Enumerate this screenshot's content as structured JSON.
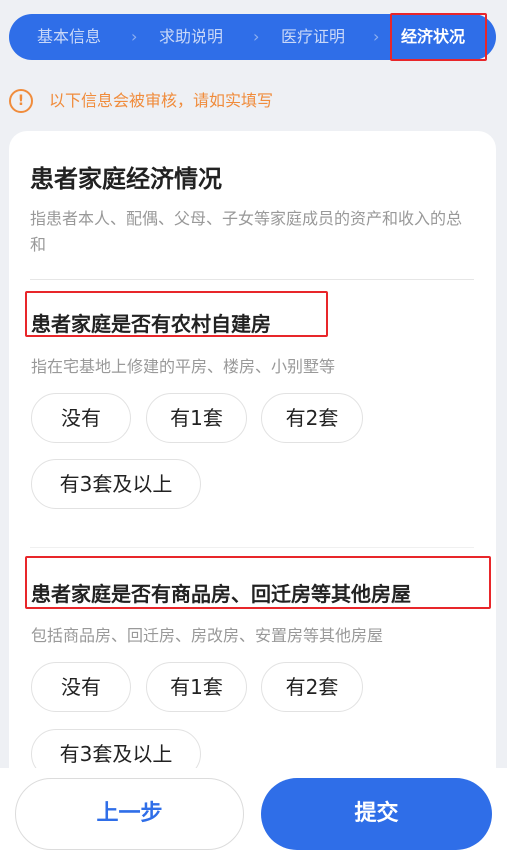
{
  "steps": {
    "step1": "基本信息",
    "step2": "求助说明",
    "step3": "医疗证明",
    "step4": "经济状况",
    "separator": "›"
  },
  "notice": {
    "icon": "!",
    "text": "以下信息会被审核，请如实填写"
  },
  "card": {
    "title": "患者家庭经济情况",
    "description": "指患者本人、配偶、父母、子女等家庭成员的资产和收入的总和"
  },
  "question1": {
    "title": "患者家庭是否有农村自建房",
    "hint": "指在宅基地上修建的平房、楼房、小别墅等",
    "options": [
      "没有",
      "有1套",
      "有2套",
      "有3套及以上"
    ]
  },
  "question2": {
    "title": "患者家庭是否有商品房、回迁房等其他房屋",
    "hint": "包括商品房、回迁房、房改房、安置房等其他房屋",
    "options": [
      "没有",
      "有1套",
      "有2套",
      "有3套及以上"
    ]
  },
  "actions": {
    "prev_label": "上一步",
    "submit_label": "提交"
  },
  "colors": {
    "primary": "#2f6ee8",
    "warning": "#f08c3c",
    "highlight": "#e8262a"
  }
}
